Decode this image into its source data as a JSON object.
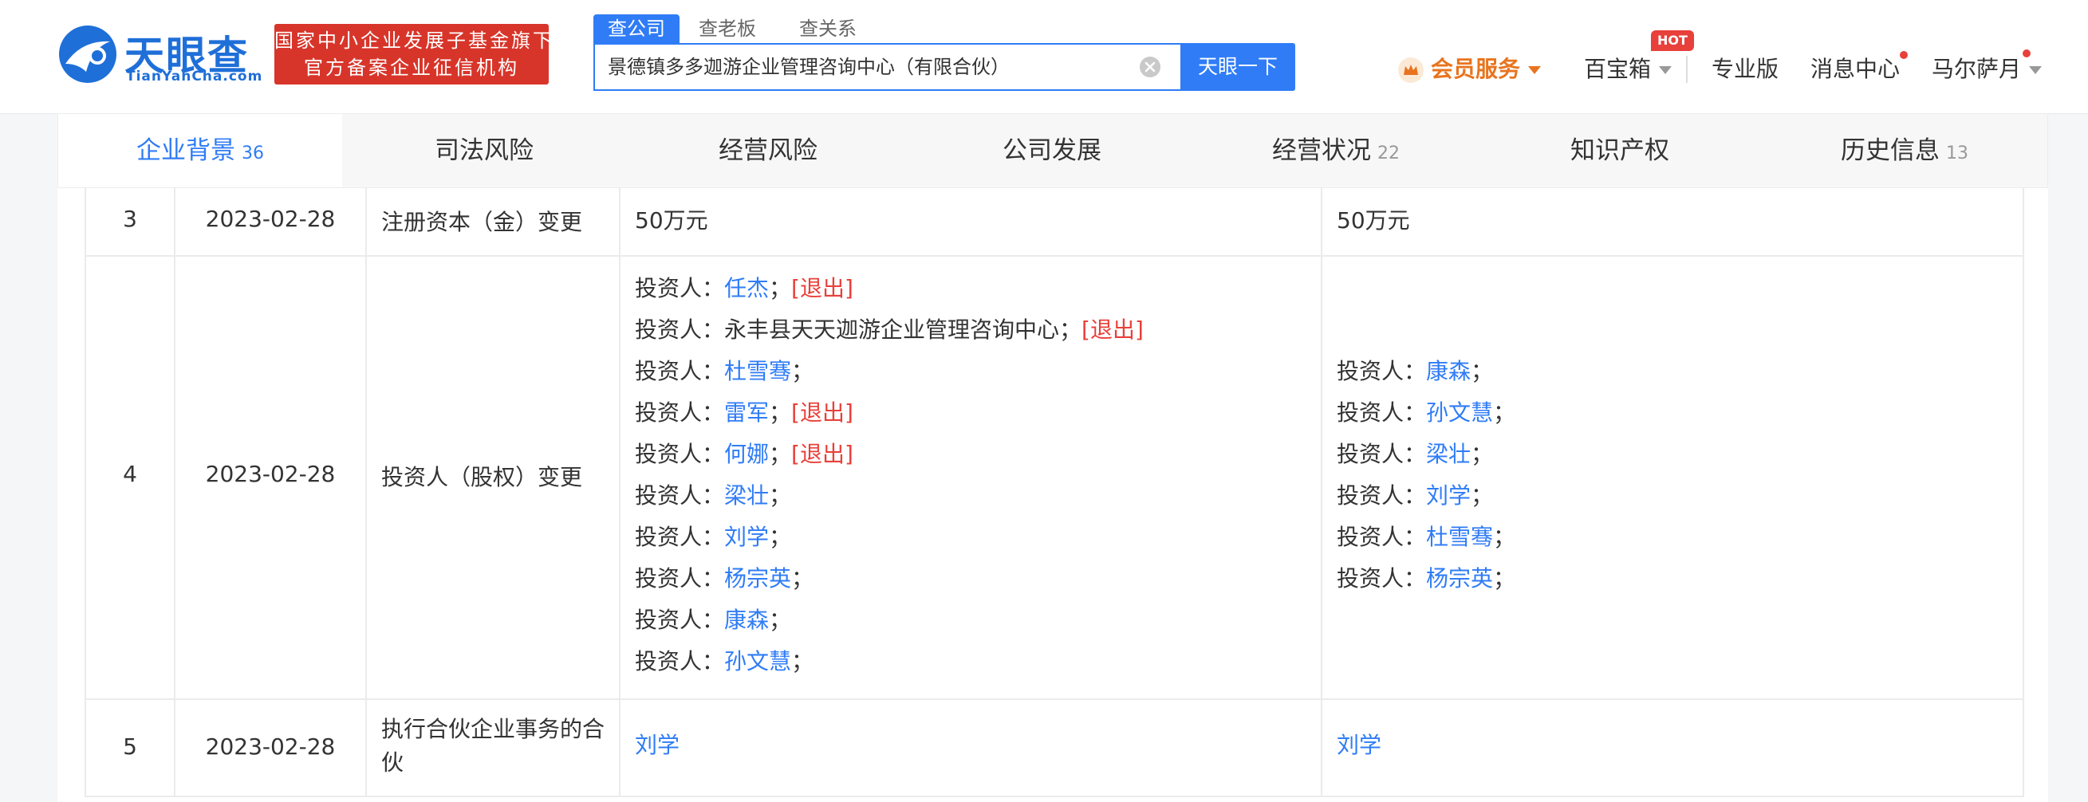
{
  "header": {
    "logo_cn": "天眼查",
    "logo_en": "TianYanCha.com",
    "badge_line1": "国家中小企业发展子基金旗下",
    "badge_line2": "官方备案企业征信机构",
    "search_tabs": [
      "查公司",
      "查老板",
      "查关系"
    ],
    "search_value": "景德镇多多迦游企业管理咨询中心（有限合伙）",
    "search_button": "天眼一下",
    "vip": "会员服务",
    "baobox": "百宝箱",
    "hot": "HOT",
    "pro": "专业版",
    "messages": "消息中心",
    "user": "马尔萨月",
    "accent": "#2f7cf6",
    "vip_color": "#e8741f",
    "alert_color": "#e8403a"
  },
  "tabs": [
    {
      "label": "企业背景",
      "count": "36"
    },
    {
      "label": "司法风险",
      "count": ""
    },
    {
      "label": "经营风险",
      "count": ""
    },
    {
      "label": "公司发展",
      "count": ""
    },
    {
      "label": "经营状况",
      "count": "22"
    },
    {
      "label": "知识产权",
      "count": ""
    },
    {
      "label": "历史信息",
      "count": "13"
    }
  ],
  "table": {
    "investor_label": "投资人：",
    "exit_label": "[退出]",
    "rows": [
      {
        "no": "3",
        "date": "2023-02-28",
        "item": "注册资本（金）变更",
        "before": "50万元",
        "after": "50万元"
      },
      {
        "no": "4",
        "date": "2023-02-28",
        "item": "投资人（股权）变更",
        "before_list": [
          {
            "name": "任杰",
            "exit": true
          },
          {
            "name": "永丰县天天迦游企业管理咨询中心",
            "exit": true,
            "plain": true
          },
          {
            "name": "杜雪骞",
            "exit": false
          },
          {
            "name": "雷军",
            "exit": true
          },
          {
            "name": "何娜",
            "exit": true
          },
          {
            "name": "梁壮",
            "exit": false
          },
          {
            "name": "刘学",
            "exit": false
          },
          {
            "name": "杨宗英",
            "exit": false
          },
          {
            "name": "康森",
            "exit": false
          },
          {
            "name": "孙文慧",
            "exit": false
          }
        ],
        "after_list": [
          {
            "name": "康森"
          },
          {
            "name": "孙文慧"
          },
          {
            "name": "梁壮"
          },
          {
            "name": "刘学"
          },
          {
            "name": "杜雪骞"
          },
          {
            "name": "杨宗英"
          }
        ]
      },
      {
        "no": "5",
        "date": "2023-02-28",
        "item": "执行合伙企业事务的合伙",
        "before": "刘学",
        "after": "刘学"
      }
    ]
  }
}
